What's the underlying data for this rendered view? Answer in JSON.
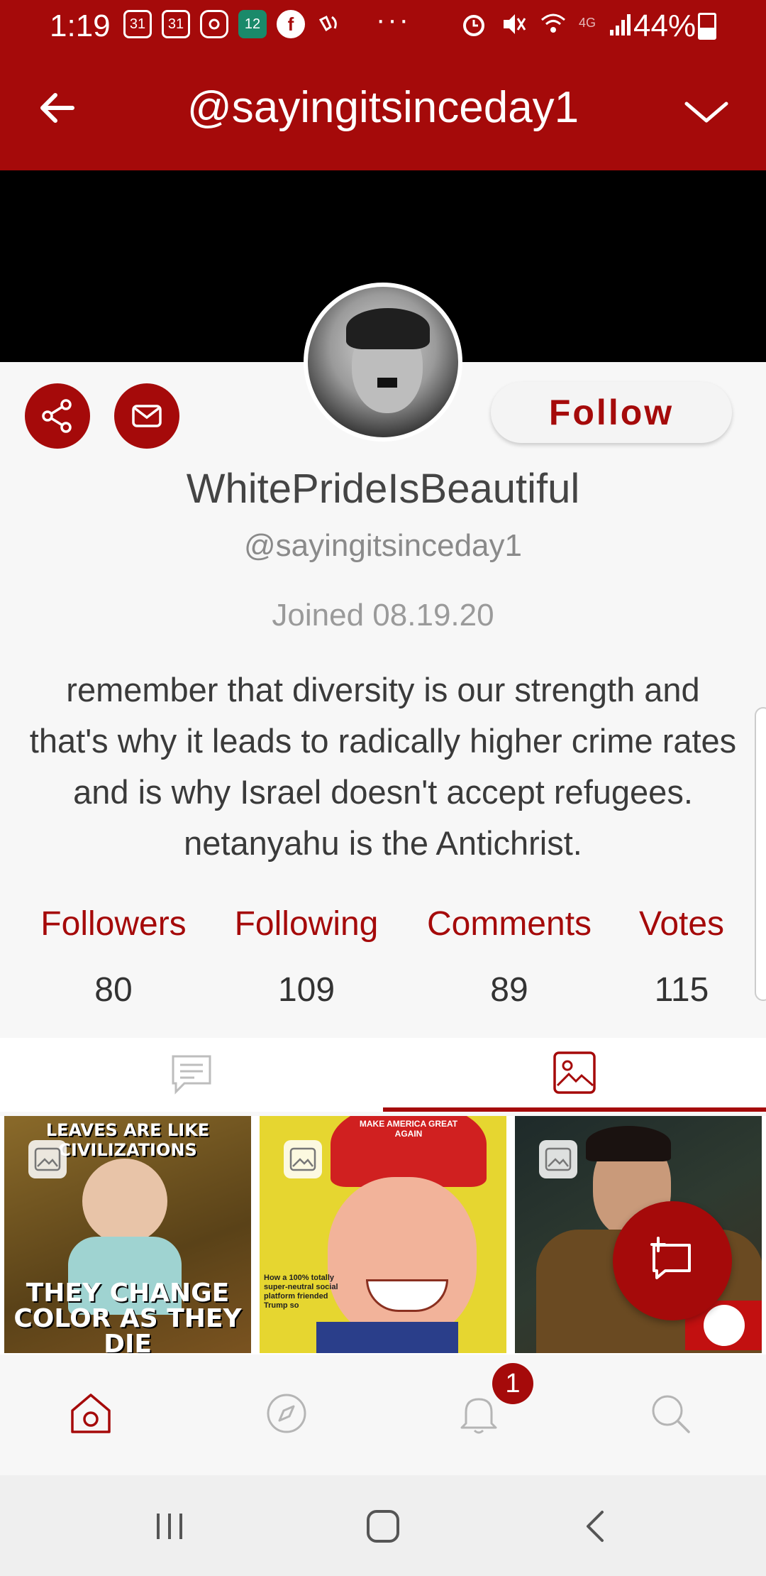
{
  "status_bar": {
    "time": "1:19",
    "left_icons": [
      "calendar-31-icon",
      "calendar-31-icon",
      "instagram-icon",
      "calendar-12-icon",
      "facebook-icon",
      "wifi-call-icon"
    ],
    "calendar_day_a": "31",
    "calendar_day_b": "31",
    "calendar_day_c": "12",
    "more_dots": "···",
    "network_label": "4G",
    "battery": "44%"
  },
  "app_bar": {
    "title": "@sayingitsinceday1"
  },
  "profile": {
    "display_name": "WhitePrideIsBeautiful",
    "handle": "@sayingitsinceday1",
    "joined": "Joined 08.19.20",
    "bio": "remember that diversity is our strength and that's why it leads to radically higher crime rates and is why Israel doesn't accept refugees. netanyahu is the Antichrist.",
    "follow_label": "Follow"
  },
  "stats": [
    {
      "label": "Followers",
      "value": "80"
    },
    {
      "label": "Following",
      "value": "109"
    },
    {
      "label": "Comments",
      "value": "89"
    },
    {
      "label": "Votes",
      "value": "115"
    }
  ],
  "tabs": [
    {
      "icon": "comments-icon",
      "active": false
    },
    {
      "icon": "images-icon",
      "active": true
    }
  ],
  "grid": {
    "tile1": {
      "top_text": "LEAVES ARE LIKE CIVILIZATIONS",
      "bottom_text": "THEY CHANGE COLOR AS THEY DIE"
    },
    "tile2": {
      "hat_text": "MAKE AMERICA GREAT AGAIN",
      "caption": "How a 100% totally super-neutral social platform friended Trump so"
    },
    "tile3": {}
  },
  "bottom_nav": [
    {
      "icon": "home-icon",
      "active": true
    },
    {
      "icon": "compass-icon",
      "active": false
    },
    {
      "icon": "bell-icon",
      "active": false,
      "badge": "1"
    },
    {
      "icon": "search-icon",
      "active": false
    }
  ],
  "colors": {
    "accent": "#a50a0a",
    "background": "#f7f7f7",
    "banner": "#000000"
  }
}
